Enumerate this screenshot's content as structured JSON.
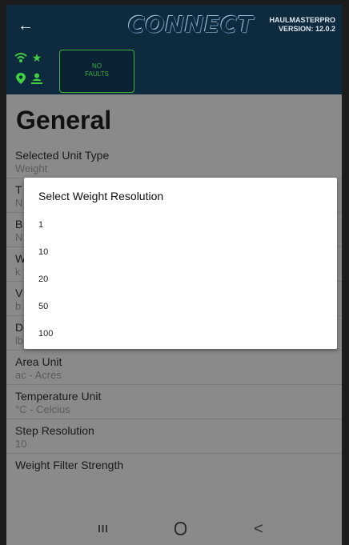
{
  "appbar": {
    "logo": "CONNECT",
    "version_line1": "HAULMASTERPRO",
    "version_line2": "VERSION: 12.0.2"
  },
  "status": {
    "faults_line1": "NO",
    "faults_line2": "FAULTS"
  },
  "page": {
    "title": "General"
  },
  "settings": [
    {
      "label": "Selected Unit Type",
      "value": "Weight"
    },
    {
      "label": "T",
      "value": "N"
    },
    {
      "label": "B",
      "value": "N"
    },
    {
      "label": "W",
      "value": "k"
    },
    {
      "label": "V",
      "value": "b"
    },
    {
      "label": "D",
      "value": "lb"
    },
    {
      "label": "Area Unit",
      "value": "ac - Acres"
    },
    {
      "label": "Temperature Unit",
      "value": "°C - Celcius"
    },
    {
      "label": "Step Resolution",
      "value": "10"
    },
    {
      "label": "Weight Filter Strength",
      "value": ""
    }
  ],
  "dialog": {
    "title": "Select Weight Resolution",
    "options": [
      "1",
      "10",
      "20",
      "50",
      "100"
    ]
  },
  "navbar": {
    "recents": "III",
    "back": "<"
  }
}
